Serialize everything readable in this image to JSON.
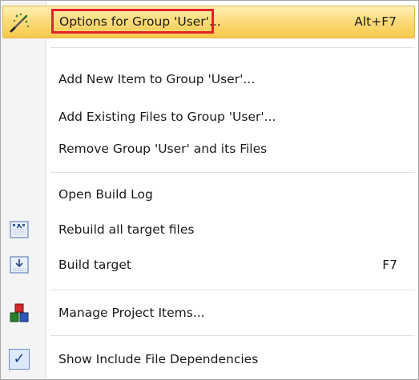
{
  "menu": {
    "items": [
      {
        "label": "Options for Group 'User'...",
        "shortcut": "Alt+F7",
        "icon": "options-wand-icon"
      },
      {
        "label": "Add New  Item to Group 'User'..."
      },
      {
        "label": "Add Existing Files to Group 'User'..."
      },
      {
        "label": "Remove Group 'User' and its Files"
      },
      {
        "label": "Open Build Log"
      },
      {
        "label": "Rebuild all target files",
        "icon": "rebuild-icon"
      },
      {
        "label": "Build target",
        "shortcut": "F7",
        "icon": "build-icon"
      },
      {
        "label": "Manage Project Items...",
        "icon": "manage-project-items-icon"
      },
      {
        "label": "Show Include File Dependencies",
        "icon": "checkmark-icon",
        "checked": true
      }
    ],
    "colors": {
      "highlight": "#f7c94b",
      "annotation_box": "#e0232c",
      "gutter": "#f4f4f4"
    }
  }
}
